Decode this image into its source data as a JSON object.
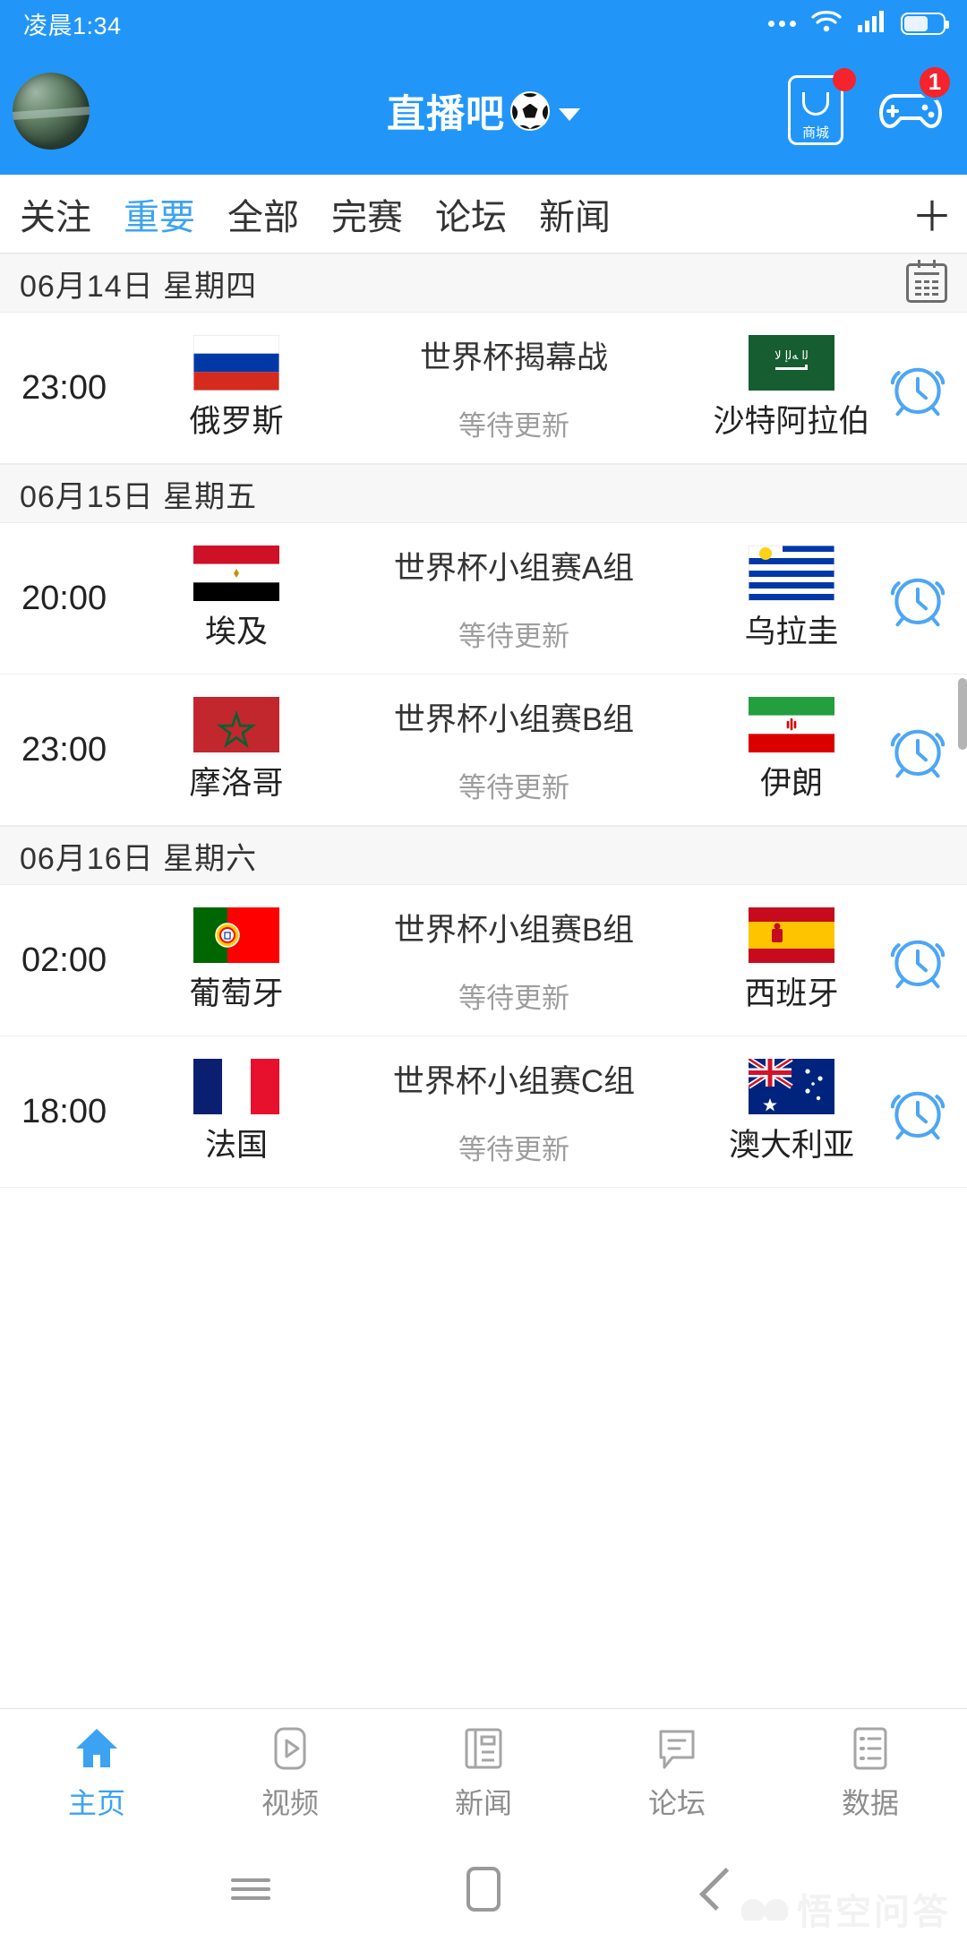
{
  "status_bar": {
    "time": "凌晨1:34",
    "icons": [
      "dots-icon",
      "wifi-icon",
      "signal-icon",
      "battery-icon"
    ]
  },
  "header": {
    "avatar_name": "user-avatar",
    "title": "直播吧",
    "ball_icon": "soccer-ball-icon",
    "caret_icon": "chevron-down-icon",
    "mall_label": "商城",
    "mall_icon": "shopping-bag-icon",
    "mall_dot": "red-dot-badge",
    "game_icon": "gamepad-icon",
    "game_badge": "1",
    "accent_color": "#2196f8",
    "badge_color": "#f5232b"
  },
  "tabs": {
    "items": [
      {
        "label": "关注",
        "active": false
      },
      {
        "label": "重要",
        "active": true
      },
      {
        "label": "全部",
        "active": false
      },
      {
        "label": "完赛",
        "active": false
      },
      {
        "label": "论坛",
        "active": false
      },
      {
        "label": "新闻",
        "active": false
      }
    ],
    "add_label": "＋",
    "active_color": "#3ba3f2"
  },
  "sections": [
    {
      "date": "06月14日 星期四",
      "has_calendar_icon": true,
      "matches": [
        {
          "time": "23:00",
          "home_team": "俄罗斯",
          "home_flag": "russia-flag",
          "away_team": "沙特阿拉伯",
          "away_flag": "saudi-arabia-flag",
          "competition": "世界杯揭幕战",
          "state": "等待更新",
          "alarm_icon": "alarm-clock-icon"
        }
      ]
    },
    {
      "date": "06月15日 星期五",
      "has_calendar_icon": false,
      "matches": [
        {
          "time": "20:00",
          "home_team": "埃及",
          "home_flag": "egypt-flag",
          "away_team": "乌拉圭",
          "away_flag": "uruguay-flag",
          "competition": "世界杯小组赛A组",
          "state": "等待更新",
          "alarm_icon": "alarm-clock-icon"
        },
        {
          "time": "23:00",
          "home_team": "摩洛哥",
          "home_flag": "morocco-flag",
          "away_team": "伊朗",
          "away_flag": "iran-flag",
          "competition": "世界杯小组赛B组",
          "state": "等待更新",
          "alarm_icon": "alarm-clock-icon"
        }
      ]
    },
    {
      "date": "06月16日 星期六",
      "has_calendar_icon": false,
      "matches": [
        {
          "time": "02:00",
          "home_team": "葡萄牙",
          "home_flag": "portugal-flag",
          "away_team": "西班牙",
          "away_flag": "spain-flag",
          "competition": "世界杯小组赛B组",
          "state": "等待更新",
          "alarm_icon": "alarm-clock-icon"
        },
        {
          "time": "18:00",
          "home_team": "法国",
          "home_flag": "france-flag",
          "away_team": "澳大利亚",
          "away_flag": "australia-flag",
          "competition": "世界杯小组赛C组",
          "state": "等待更新",
          "alarm_icon": "alarm-clock-icon"
        }
      ]
    }
  ],
  "bottom_nav": {
    "items": [
      {
        "label": "主页",
        "icon": "home-icon",
        "active": true
      },
      {
        "label": "视频",
        "icon": "play-video-icon",
        "active": false
      },
      {
        "label": "新闻",
        "icon": "newspaper-icon",
        "active": false
      },
      {
        "label": "论坛",
        "icon": "chat-bubble-icon",
        "active": false
      },
      {
        "label": "数据",
        "icon": "list-data-icon",
        "active": false
      }
    ],
    "active_color": "#3ba3f2"
  },
  "android_nav": {
    "menu_icon": "menu-icon",
    "home_icon": "home-square-icon",
    "back_icon": "back-chevron-icon"
  },
  "watermark": {
    "text": "悟空问答",
    "icon": "cloud-logo-icon"
  }
}
